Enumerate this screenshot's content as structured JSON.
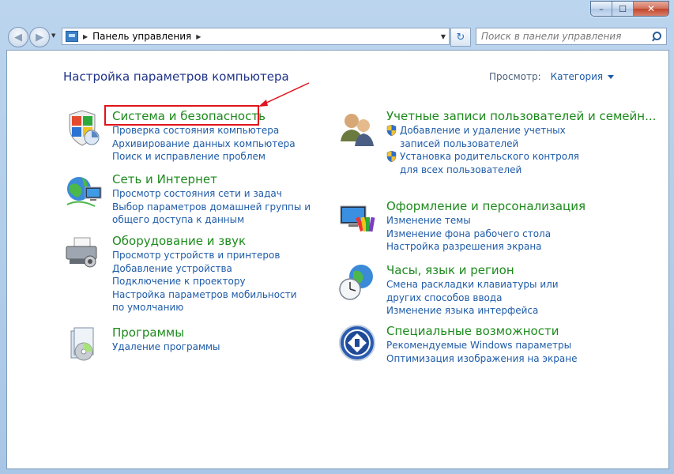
{
  "window": {
    "minimize": "–",
    "maximize": "☐",
    "close": "✕"
  },
  "nav": {
    "back": "◀",
    "forward": "▶",
    "breadcrumb": "Панель управления",
    "refresh": "↻",
    "search_placeholder": "Поиск в панели управления"
  },
  "page": {
    "heading": "Настройка параметров компьютера",
    "view_label": "Просмотр:",
    "view_value": "Категория"
  },
  "categories": {
    "system": {
      "title": "Система и безопасность",
      "links": [
        "Проверка состояния компьютера",
        "Архивирование данных компьютера",
        "Поиск и исправление проблем"
      ]
    },
    "network": {
      "title": "Сеть и Интернет",
      "links": [
        "Просмотр состояния сети и задач",
        "Выбор параметров домашней группы и общего доступа к данным"
      ]
    },
    "hardware": {
      "title": "Оборудование и звук",
      "links": [
        "Просмотр устройств и принтеров",
        "Добавление устройства",
        "Подключение к проектору",
        "Настройка параметров мобильности по умолчанию"
      ]
    },
    "programs": {
      "title": "Программы",
      "links": [
        "Удаление программы"
      ]
    },
    "users": {
      "title": "Учетные записи пользователей и семейн...",
      "links": [
        "Добавление и удаление учетных записей пользователей",
        "Установка родительского контроля для всех пользователей"
      ]
    },
    "appearance": {
      "title": "Оформление и персонализация",
      "links": [
        "Изменение темы",
        "Изменение фона рабочего стола",
        "Настройка разрешения экрана"
      ]
    },
    "clock": {
      "title": "Часы, язык и регион",
      "links": [
        "Смена раскладки клавиатуры или других способов ввода",
        "Изменение языка интерфейса"
      ]
    },
    "access": {
      "title": "Специальные возможности",
      "links": [
        "Рекомендуемые Windows параметры",
        "Оптимизация изображения на экране"
      ]
    }
  },
  "colors": {
    "category_title": "#1d8a1d",
    "link": "#1e5ba8",
    "heading": "#1e3287",
    "highlight": "#e0141b"
  }
}
